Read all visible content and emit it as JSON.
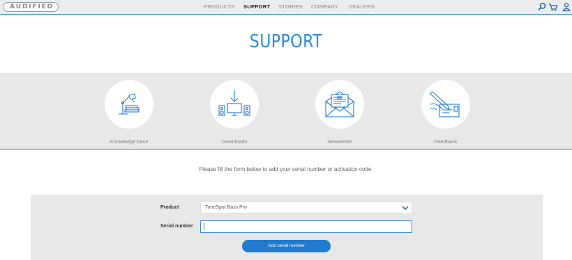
{
  "header": {
    "logo_text": "AUDIFIED",
    "nav": [
      "PRODUCTS",
      "SUPPORT",
      "STORIES",
      "COMPANY",
      "DEALERS"
    ],
    "active_nav": "SUPPORT",
    "icons": [
      "search-icon",
      "cart-icon",
      "user-icon"
    ]
  },
  "page": {
    "title": "SUPPORT"
  },
  "support_links": [
    {
      "label": "Knowledge base",
      "icon": "lamp-books-icon"
    },
    {
      "label": "Downloads",
      "icon": "download-speakers-icon"
    },
    {
      "label": "Newsletter",
      "icon": "envelope-icon"
    },
    {
      "label": "Feedback",
      "icon": "pen-writing-icon"
    }
  ],
  "form": {
    "instruction": "Please fill the form below to add your serial number or activation code.",
    "product_label": "Product",
    "product_value": "ToneSpot Bass Pro",
    "serial_label": "Serial number",
    "serial_value": "",
    "submit_label": "Add serial number"
  },
  "colors": {
    "accent": "#1f7ad0",
    "title": "#2a8ad8",
    "band_bg": "#e8e8e8",
    "topbar_bg": "#ececec"
  }
}
